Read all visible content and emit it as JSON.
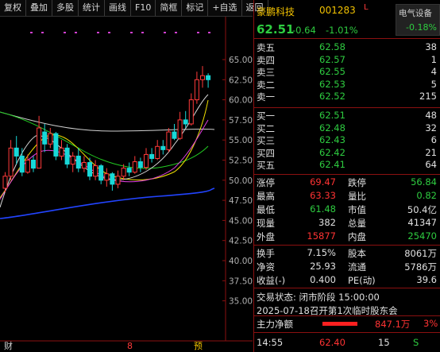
{
  "toolbar": [
    "复权",
    "叠加",
    "多股",
    "统计",
    "画线",
    "F10",
    "简框",
    "标记",
    "+自选",
    "返回"
  ],
  "chart": {
    "y_labels": [
      "65.00",
      "62.50",
      "60.00",
      "57.50",
      "55.00",
      "52.50",
      "50.00",
      "47.50",
      "45.00",
      "42.50",
      "40.00",
      "37.50",
      "35.00"
    ],
    "bottom_marks": [
      "财",
      "8",
      "预"
    ]
  },
  "quote": {
    "name": "豪鹏科技",
    "code": "001283",
    "l_mark": "L",
    "sector": "电气设备",
    "sector_pct": "-0.18%",
    "price": "62.51",
    "change": "-0.64",
    "change_pct": "-1.01%"
  },
  "asks": [
    {
      "label": "卖五",
      "price": "62.58",
      "vol": "38"
    },
    {
      "label": "卖四",
      "price": "62.57",
      "vol": "1"
    },
    {
      "label": "卖三",
      "price": "62.55",
      "vol": "4"
    },
    {
      "label": "卖二",
      "price": "62.53",
      "vo​l": "5",
      "vol": "5"
    },
    {
      "label": "卖一",
      "price": "62.52",
      "vol": "215"
    }
  ],
  "bids": [
    {
      "label": "买一",
      "price": "62.51",
      "vol": "48"
    },
    {
      "label": "买二",
      "price": "62.48",
      "vol": "32"
    },
    {
      "label": "买三",
      "price": "62.43",
      "vol": "6"
    },
    {
      "label": "买四",
      "price": "62.42",
      "vol": "21"
    },
    {
      "label": "买五",
      "price": "62.41",
      "vol": "64"
    }
  ],
  "stats": [
    {
      "l1": "涨停",
      "v1": "69.47",
      "c1": "red",
      "l2": "跌停",
      "v2": "56.84",
      "c2": "green"
    },
    {
      "l1": "最高",
      "v1": "63.33",
      "c1": "red",
      "l2": "量比",
      "v2": "0.82",
      "c2": "green"
    },
    {
      "l1": "最低",
      "v1": "61.48",
      "c1": "green",
      "l2": "市值",
      "v2": "50.4亿",
      "c2": "white"
    },
    {
      "l1": "现量",
      "v1": "382",
      "c1": "white",
      "l2": "总量",
      "v2": "41347",
      "c2": "white"
    },
    {
      "l1": "外盘",
      "v1": "15877",
      "c1": "red",
      "l2": "内盘",
      "v2": "25470",
      "c2": "green"
    }
  ],
  "stats2": [
    {
      "l1": "换手",
      "v1": "7.15%",
      "l2": "股本",
      "v2": "8061万"
    },
    {
      "l1": "净资",
      "v1": "25.93",
      "l2": "流通",
      "v2": "5786万"
    },
    {
      "l1": "收益(-)",
      "v1": "0.400",
      "l2": "PE(动)",
      "v2": "39.6"
    }
  ],
  "status": "交易状态: 闭市阶段 15:00:00",
  "notice": "2025-07-18召开第1次临时股东会",
  "mainflow": {
    "label": "主力净额",
    "value": "847.1万",
    "pct": "3%"
  },
  "last_trade": {
    "time": "14:55",
    "price": "62.40",
    "vol": "15",
    "dir": "S"
  },
  "colors": {
    "up": "#ff3333",
    "down": "#2ecc40",
    "accent": "#f0c000"
  }
}
